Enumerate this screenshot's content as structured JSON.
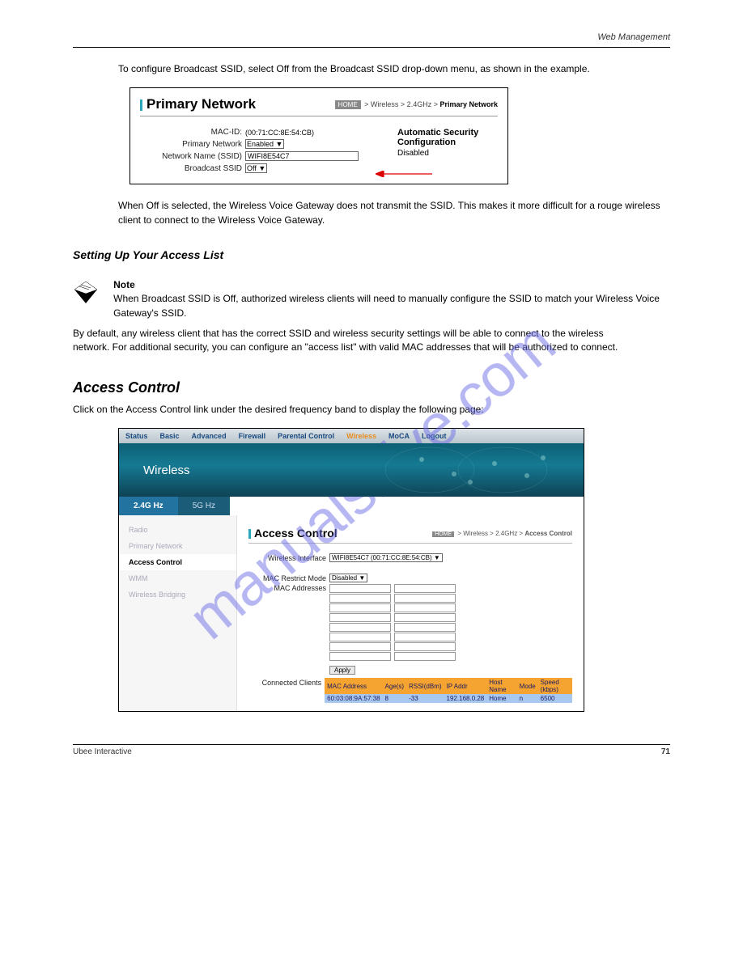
{
  "watermark": "manualshive.com",
  "doc_header": "Web Management",
  "intro_text": "To configure Broadcast SSID, select Off from the Broadcast SSID drop-down menu, as shown in the example.",
  "fig1": {
    "title": "Primary Network",
    "breadcrumb_home": "HOME",
    "breadcrumb_path": " > Wireless > 2.4GHz > ",
    "breadcrumb_current": "Primary Network",
    "mac_id_label": "MAC-ID:",
    "mac_id_value": "(00:71:CC:8E:54:CB)",
    "primary_network_label": "Primary Network",
    "primary_network_value": "Enabled",
    "ssid_label": "Network Name (SSID)",
    "ssid_value": "WIFI8E54C7",
    "broadcast_label": "Broadcast SSID",
    "broadcast_value": "Off",
    "asc_title": "Automatic Security",
    "asc_title2": "Configuration",
    "asc_value": "Disabled"
  },
  "mid_text": "When Off is selected, the Wireless Voice Gateway does not transmit the SSID. This makes it more difficult for a rouge wireless client to connect to the Wireless Voice Gateway.",
  "note": {
    "label": "Note",
    "text": "When Broadcast SSID is Off, authorized wireless clients will need to manually configure the SSID to match your Wireless Voice Gateway's SSID."
  },
  "section_access_note_h": "Setting Up Your Access List",
  "section_access_note_p": "By default, any wireless client that has the correct SSID and wireless security settings will be able to connect to the wireless network. For additional security, you can configure an \"access list\" with valid MAC addresses that will be authorized to connect.",
  "section_access_h": "Access Control",
  "section_access_p": "Click on the Access Control link under the desired frequency band to display the following page:",
  "fig2": {
    "topnav": [
      "Status",
      "Basic",
      "Advanced",
      "Firewall",
      "Parental Control",
      "Wireless",
      "MoCA",
      "Logout"
    ],
    "topnav_active": "Wireless",
    "banner": "Wireless",
    "tabs": [
      "2.4G Hz",
      "5G Hz"
    ],
    "tab_active": "2.4G Hz",
    "side": [
      "Radio",
      "Primary Network",
      "Access Control",
      "WMM",
      "Wireless Bridging"
    ],
    "side_active": "Access Control",
    "title": "Access Control",
    "breadcrumb_home": "HOME",
    "breadcrumb_path": " > Wireless > 2.4GHz > ",
    "breadcrumb_current": "Access Control",
    "wi_label": "Wireless Interface",
    "wi_value": "WIFI8E54C7 (00:71:CC:8E:54:CB)",
    "mrm_label": "MAC Restrict Mode",
    "mrm_value": "Disabled",
    "mac_addr_label": "MAC Addresses",
    "apply": "Apply",
    "cc_label": "Connected Clients",
    "table": {
      "headers": [
        "MAC Address",
        "Age(s)",
        "RSSI(dBm)",
        "IP Addr",
        "Host Name",
        "Mode",
        "Speed (kbps)"
      ],
      "row": [
        "60:03:08:9A:57:38",
        "8",
        "-33",
        "192.168.0.28",
        "Home",
        "n",
        "6500"
      ]
    }
  },
  "footer_left": "Ubee Interactive",
  "footer_right": "71"
}
